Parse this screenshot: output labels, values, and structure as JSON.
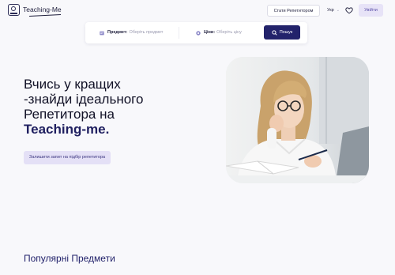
{
  "header": {
    "logo_text": "Teaching-Me",
    "become_tutor": "Стати Репетитором",
    "language": "Укр",
    "login": "Увійти"
  },
  "search": {
    "subject_label": "Предмет:",
    "subject_placeholder": "Оберіть предмет",
    "price_label": "Ціни:",
    "price_placeholder": "Оберіть ціну",
    "button": "Пошук"
  },
  "hero": {
    "title_line1": "Вчись у кращих",
    "title_line2": "-знайди ідеального",
    "title_line3": "Репетитора на",
    "title_brand": "Teaching-me.",
    "cta": "Залишити запит на підбір репетитора"
  },
  "sections": {
    "popular_subjects": "Популярні Предмети"
  },
  "icons": {
    "logo": "logo-icon",
    "heart": "heart-icon",
    "subject": "subject-icon",
    "price": "price-icon",
    "search": "search-icon"
  },
  "colors": {
    "brand_navy": "#23236b",
    "accent_lavender": "#e4e0f6",
    "background": "#f8f8fb"
  }
}
